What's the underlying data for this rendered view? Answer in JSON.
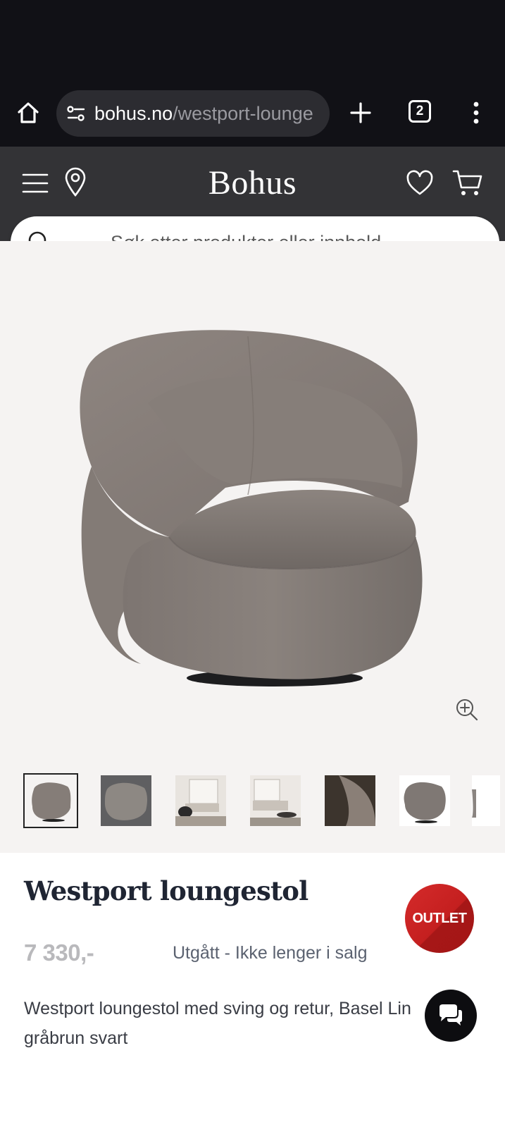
{
  "browser": {
    "url_domain": "bohus.no",
    "url_path": "/westport-lounge",
    "tab_count": "2"
  },
  "header": {
    "logo": "Bohus"
  },
  "search": {
    "placeholder": "Søk etter produkter eller innhold..."
  },
  "gallery": {
    "thumbnail_count": 7,
    "selected_index": 0
  },
  "product": {
    "title": "Westport loungestol",
    "badge": "OUTLET",
    "price": "7 330,-",
    "status": "Utgått - Ikke lenger i salg",
    "description": "Westport loungestol med sving og retur, Basel Lin gråbrun svart"
  },
  "colors": {
    "header_bg": "#333336",
    "browser_bg": "#111116",
    "badge_red": "#c41f1f",
    "title_color": "#1f2533"
  }
}
